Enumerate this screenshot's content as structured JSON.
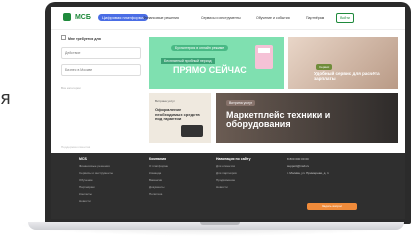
{
  "page": {
    "stray_glyph": "я"
  },
  "header": {
    "logo": "МСБ",
    "badge": "Цифровая платформа",
    "nav": [
      "Финансовые решения",
      "Сервисы и инструменты",
      "Обучение и события",
      "Партнёрам"
    ],
    "login": "Войти"
  },
  "sidebar": {
    "title": "Мне требуется для",
    "fields": [
      "Действие",
      "Бизнес в Москве"
    ],
    "muted": "Все категории",
    "footer_note": "Поддержка клиентов"
  },
  "banners": {
    "b1": {
      "tag": "Бухгалтерия в онлайн режиме",
      "sub": "Бесплатный пробный период",
      "big": "ПРЯМО СЕЙЧАС"
    },
    "b2": {
      "tag": "Сервис",
      "txt": "Удобный сервис для расчёта зарплаты"
    },
    "b3": {
      "tag": "Витрина услуг",
      "txt": "Оформление необходимых средств под гарантии"
    },
    "b4": {
      "tag": "Витрина услуг",
      "txt": "Маркетплейс техники и оборудования"
    }
  },
  "footer": {
    "cols": [
      {
        "title": "МСБ",
        "items": [
          "Финансовые решения",
          "Сервисы и инструменты",
          "Обучение",
          "Партнёрам",
          "Контакты",
          "Новости"
        ]
      },
      {
        "title": "Компания",
        "items": [
          "О платформе",
          "Команда",
          "Вакансии",
          "Документы",
          "Политика"
        ]
      },
      {
        "title": "Навигация по сайту",
        "items": [
          "Для клиентов",
          "Для партнёров",
          "Продвижение",
          "Новости"
        ]
      }
    ],
    "contacts": [
      "8 800 000 00 00",
      "support@msb.ru",
      "г. Москва, ул. Примерная, д. 1"
    ],
    "button": "Задать вопрос"
  },
  "colors": {
    "brand": "#1f8a3c",
    "accent": "#f08b3a",
    "banner_green": "#7fe0b0"
  }
}
